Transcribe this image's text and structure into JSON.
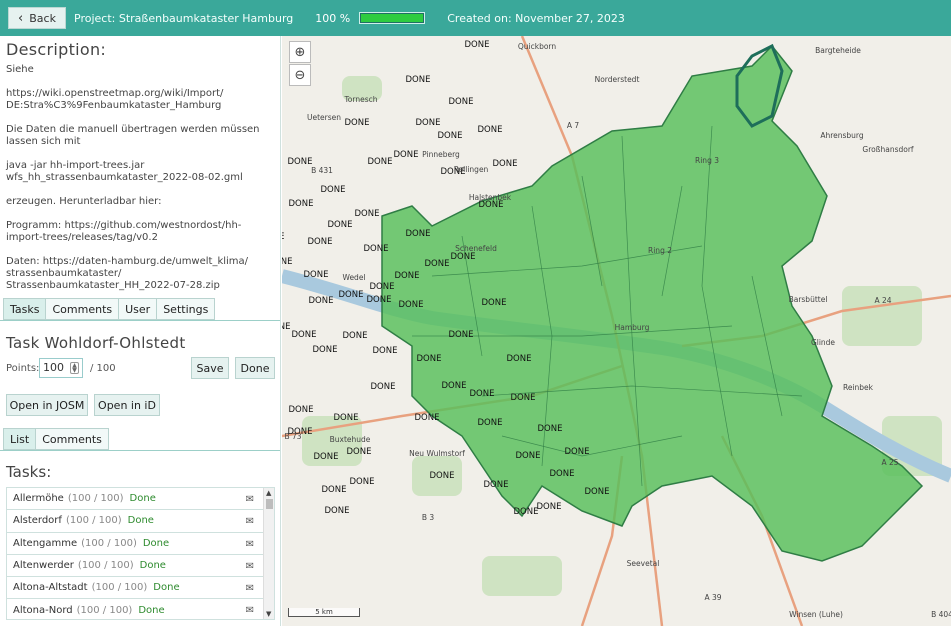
{
  "topbar": {
    "back_label": "Back",
    "project": "Project: Straßenbaumkataster Hamburg",
    "progress_text": "100 %",
    "progress_fraction": 1.0,
    "created": "Created on: November 27, 2023"
  },
  "description": {
    "title": "Description:",
    "paragraphs": [
      "Siehe",
      "https://wiki.openstreetmap.org/wiki/Import/\nDE:Stra%C3%9Fenbaumkataster_Hamburg",
      "Die Daten die manuell übertragen werden müssen\nlassen sich mit",
      "java -jar hh-import-trees.jar\nwfs_hh_strassenbaumkataster_2022-08-02.gml",
      "erzeugen. Herunterladbar hier:",
      "Programm: https://github.com/westnordost/hh-\nimport-trees/releases/tag/v0.2",
      "Daten: https://daten-hamburg.de/umwelt_klima/\nstrassenbaumkataster/\nStrassenbaumkataster_HH_2022-07-28.zip"
    ]
  },
  "main_tabs": [
    "Tasks",
    "Comments",
    "User",
    "Settings"
  ],
  "task": {
    "title": "Task Wohldorf-Ohlstedt",
    "points_label": "Points:",
    "points_value": "100",
    "points_max": "/ 100",
    "save_label": "Save",
    "done_label": "Done",
    "josm_label": "Open in JOSM",
    "id_label": "Open in iD"
  },
  "sub_tabs": [
    "List",
    "Comments"
  ],
  "tasks": {
    "title": "Tasks:",
    "items": [
      {
        "name": "Allermöhe",
        "points": "(100 / 100)",
        "status": "Done"
      },
      {
        "name": "Alsterdorf",
        "points": "(100 / 100)",
        "status": "Done"
      },
      {
        "name": "Altengamme",
        "points": "(100 / 100)",
        "status": "Done"
      },
      {
        "name": "Altenwerder",
        "points": "(100 / 100)",
        "status": "Done"
      },
      {
        "name": "Altona-Altstadt",
        "points": "(100 / 100)",
        "status": "Done"
      },
      {
        "name": "Altona-Nord",
        "points": "(100 / 100)",
        "status": "Done"
      }
    ]
  },
  "map": {
    "zoom_in": "⊕",
    "zoom_out": "⊖",
    "scale_label": "5 km",
    "done_text": "DONE",
    "places": [
      "Quickborn",
      "Bargteheide",
      "Norderstedt",
      "Tornesch",
      "Uetersen",
      "Ahrensburg",
      "Pinneberg",
      "Großhansdorf",
      "Rellingen",
      "Halstenbek",
      "Schenefeld",
      "Wedel",
      "Hamburg",
      "Barsbüttel",
      "Glinde",
      "Reinbek",
      "Buxtehude",
      "Neu Wulmstorf",
      "Seevetal",
      "Winsen (Luhe)",
      "A 7",
      "A 24",
      "A 25",
      "A 39",
      "B 73",
      "B 431",
      "B 3",
      "B 404",
      "Ring 3",
      "Ring 2"
    ],
    "colors": {
      "district_fill": "#57c05a",
      "district_stroke": "#2f7d45",
      "selected_stroke": "#1e6e5a",
      "water": "#a9c9de",
      "land": "#f1efe9"
    }
  }
}
